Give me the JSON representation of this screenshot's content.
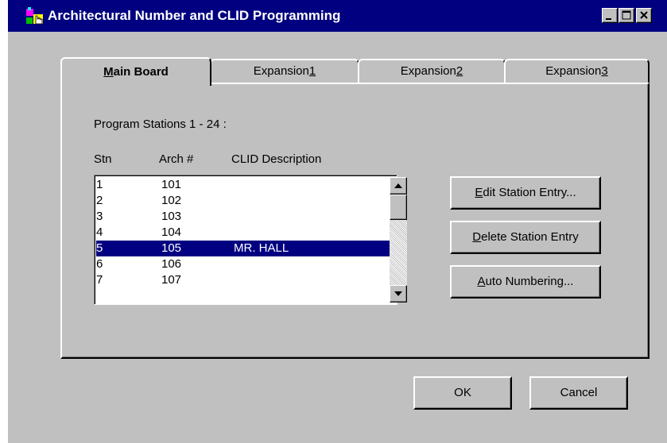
{
  "window": {
    "title": "Architectural Number and CLID Programming"
  },
  "tabs": [
    {
      "pre": "",
      "key": "M",
      "post": "ain Board",
      "active": true
    },
    {
      "pre": "Expansion ",
      "key": "1",
      "post": "",
      "active": false
    },
    {
      "pre": "Expansion ",
      "key": "2",
      "post": "",
      "active": false
    },
    {
      "pre": "Expansion ",
      "key": "3",
      "post": "",
      "active": false
    }
  ],
  "panel": {
    "heading": "Program Stations 1 - 24 :",
    "columns": {
      "stn": "Stn",
      "arch": "Arch #",
      "clid": "CLID Description"
    },
    "rows": [
      {
        "stn": "1",
        "arch": "101",
        "clid": ""
      },
      {
        "stn": "2",
        "arch": "102",
        "clid": ""
      },
      {
        "stn": "3",
        "arch": "103",
        "clid": ""
      },
      {
        "stn": "4",
        "arch": "104",
        "clid": ""
      },
      {
        "stn": "5",
        "arch": "105",
        "clid": "MR. HALL"
      },
      {
        "stn": "6",
        "arch": "106",
        "clid": ""
      },
      {
        "stn": "7",
        "arch": "107",
        "clid": ""
      }
    ],
    "selected_row": 4
  },
  "buttons": {
    "edit": {
      "pre": "",
      "key": "E",
      "post": "dit Station Entry..."
    },
    "delete": {
      "pre": "",
      "key": "D",
      "post": "elete Station Entry"
    },
    "auto": {
      "pre": "",
      "key": "A",
      "post": "uto Numbering..."
    },
    "ok": "OK",
    "cancel": "Cancel"
  },
  "colors": {
    "titlebar": "#000080",
    "face": "#c0c0c0",
    "selection": "#000080"
  }
}
